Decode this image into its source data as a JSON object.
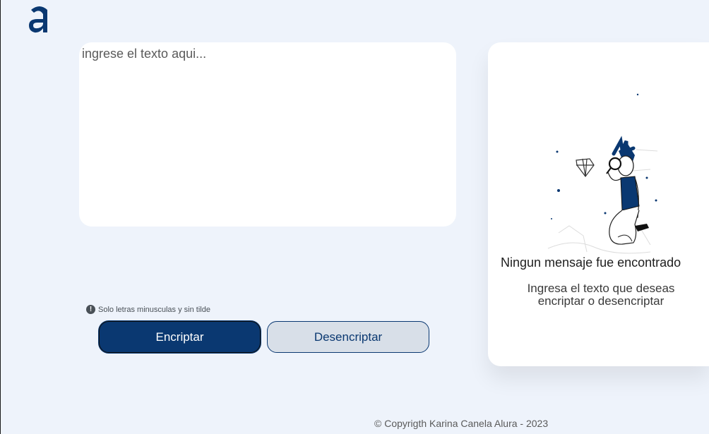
{
  "header": {
    "logo_icon": "alura-a-logo-icon",
    "logo_color": "#0a3871"
  },
  "input": {
    "placeholder": "ingrese el texto aqui...",
    "value": ""
  },
  "hint": {
    "icon": "info-icon",
    "text": "Solo letras minusculas y sin tilde"
  },
  "buttons": {
    "encrypt_label": "Encriptar",
    "decrypt_label": "Desencriptar"
  },
  "result": {
    "illustration": "person-with-magnifier-illustration",
    "title": "Ningun mensaje fue encontrado",
    "text": "Ingresa el texto que deseas encriptar o desencriptar"
  },
  "footer": {
    "copyright": "© Copyrigth Karina Canela Alura - 2023"
  },
  "colors": {
    "background": "#eef3fb",
    "primary": "#0a3871",
    "secondary": "#d8dfe8"
  }
}
